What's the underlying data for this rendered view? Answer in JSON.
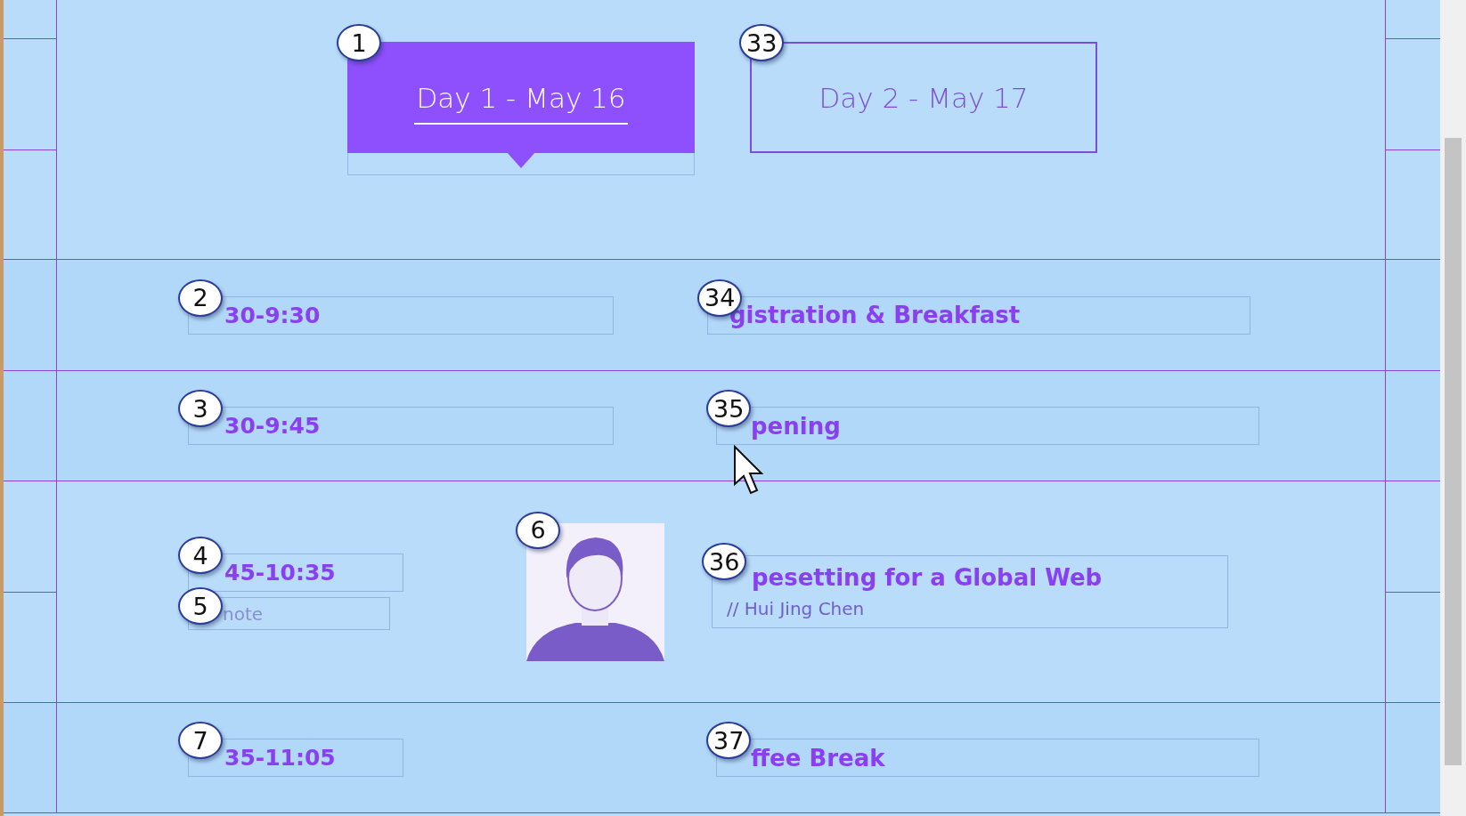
{
  "tabs": [
    {
      "label": "Day 1 - May 16",
      "badge": "1",
      "selected": true
    },
    {
      "label": "Day 2 - May 17",
      "badge": "33",
      "selected": false
    }
  ],
  "sessions": [
    {
      "kind": "plain",
      "time": "30-9:30",
      "time_badge": "2",
      "title": "gistration & Breakfast",
      "title_badge": "34"
    },
    {
      "kind": "plain",
      "time": "30-9:45",
      "time_badge": "3",
      "title": "pening",
      "title_badge": "35"
    },
    {
      "kind": "talk",
      "time": "45-10:35",
      "time_badge": "4",
      "tag": "note",
      "tag_badge": "5",
      "photo_badge": "6",
      "title": "pesetting for a Global Web",
      "title_badge": "36",
      "speaker": "// Hui Jing Chen"
    },
    {
      "kind": "plain",
      "time": "35-11:05",
      "time_badge": "7",
      "title": "ffee Break",
      "title_badge": "37"
    }
  ]
}
